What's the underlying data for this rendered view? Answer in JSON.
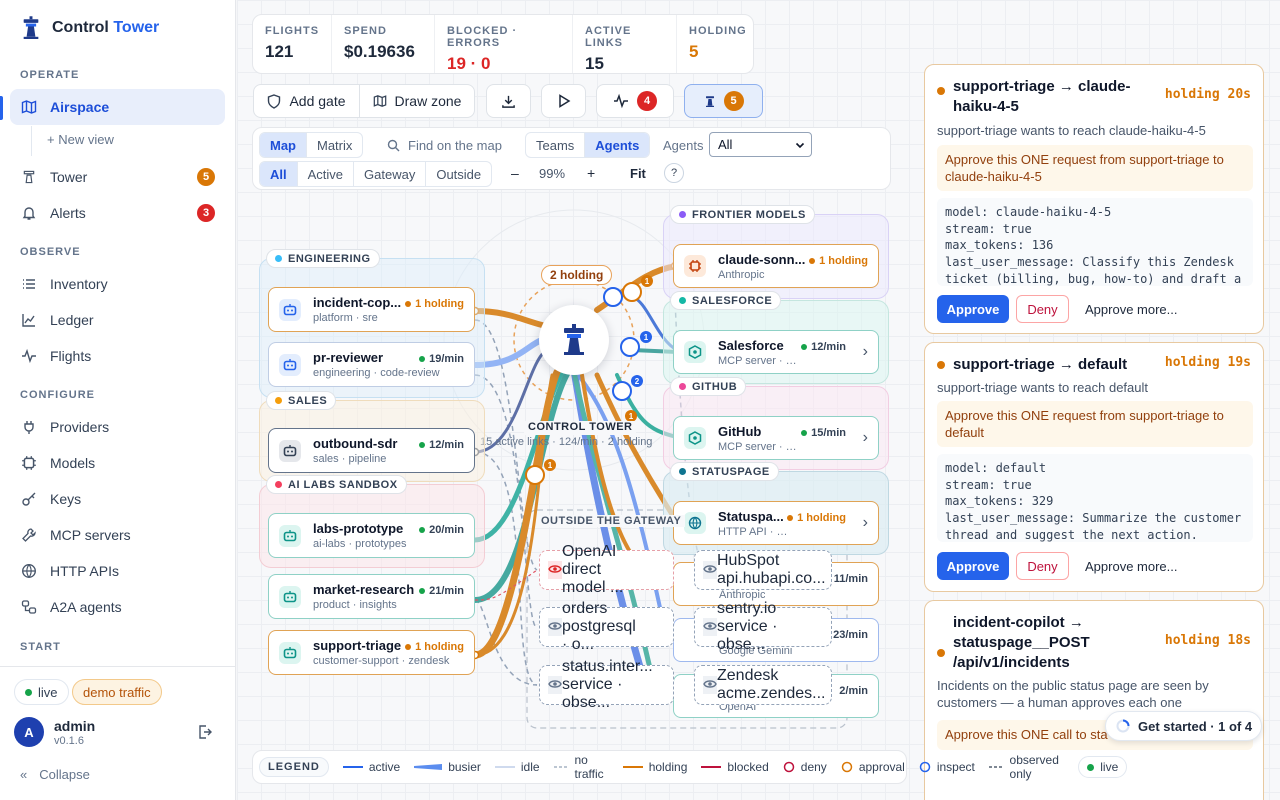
{
  "app": {
    "title_main": "Control",
    "title_accent": "Tower"
  },
  "sidebar": {
    "sections": {
      "operate": "OPERATE",
      "observe": "OBSERVE",
      "configure": "CONFIGURE",
      "start": "START"
    },
    "items": [
      {
        "label": "Airspace",
        "icon": "map-icon"
      },
      {
        "label": "Tower",
        "icon": "tower-icon",
        "badge": "5"
      },
      {
        "label": "Alerts",
        "icon": "bell-icon",
        "badge": "3"
      },
      {
        "label": "Inventory",
        "icon": "list-icon"
      },
      {
        "label": "Ledger",
        "icon": "line-chart-icon"
      },
      {
        "label": "Flights",
        "icon": "pulse-icon"
      },
      {
        "label": "Providers",
        "icon": "plug-icon"
      },
      {
        "label": "Models",
        "icon": "chip-icon"
      },
      {
        "label": "Keys",
        "icon": "key-icon"
      },
      {
        "label": "MCP servers",
        "icon": "wrench-icon"
      },
      {
        "label": "HTTP APIs",
        "icon": "globe-icon"
      },
      {
        "label": "A2A agents",
        "icon": "agents-icon"
      }
    ],
    "new_view": "+ New view",
    "live": "live",
    "demo": "demo traffic",
    "user": {
      "initial": "A",
      "name": "admin",
      "version": "v0.1.6"
    },
    "collapse": "Collapse"
  },
  "stats": [
    {
      "label": "FLIGHTS",
      "value": "121"
    },
    {
      "label": "SPEND",
      "value": "$0.19636"
    },
    {
      "label": "BLOCKED · ERRORS",
      "value": "19 · 0"
    },
    {
      "label": "ACTIVE LINKS",
      "value": "15"
    },
    {
      "label": "HOLDING",
      "value": "5"
    }
  ],
  "toolbar": {
    "add_gate": "Add gate",
    "draw_zone": "Draw zone",
    "alerts_count": "4",
    "tower_count": "5"
  },
  "filters": {
    "view_tabs": [
      "Map",
      "Matrix"
    ],
    "search_placeholder": "Find on the map",
    "group_tabs": [
      "Teams",
      "Agents"
    ],
    "agents_label": "Agents",
    "agents_selected": "All",
    "scope_tabs": [
      "All",
      "Active",
      "Gateway",
      "Outside"
    ],
    "zoom_minus": "–",
    "zoom": "99%",
    "zoom_plus": "+",
    "fit": "Fit",
    "help": "?"
  },
  "map": {
    "tower": {
      "label": "CONTROL TOWER",
      "sub": "15 active links · 124/min · 2 holding",
      "holding": "2 holding"
    },
    "groups": {
      "engineering": "ENGINEERING",
      "sales": "SALES",
      "ailabs": "AI LABS SANDBOX",
      "frontier": "FRONTIER MODELS",
      "salesforce": "SALESFORCE",
      "github": "GITHUB",
      "statuspage": "STATUSPAGE",
      "outside": "OUTSIDE THE GATEWAY"
    },
    "agents": [
      {
        "name": "incident-cop...",
        "sub": "platform · sre",
        "status": "1 holding"
      },
      {
        "name": "pr-reviewer",
        "sub": "engineering · code-review",
        "status": "19/min"
      },
      {
        "name": "outbound-sdr",
        "sub": "sales · pipeline",
        "status": "12/min"
      },
      {
        "name": "labs-prototype",
        "sub": "ai-labs · prototypes",
        "status": "20/min"
      },
      {
        "name": "market-research",
        "sub": "product · insights",
        "status": "21/min"
      },
      {
        "name": "support-triage",
        "sub": "customer-support · zendesk",
        "status": "1 holding"
      }
    ],
    "targets": [
      {
        "name": "claude-sonn...",
        "sub": "Anthropic",
        "status": "1 holding"
      },
      {
        "name": "Salesforce",
        "sub": "MCP server · 3 tools",
        "status": "12/min"
      },
      {
        "name": "GitHub",
        "sub": "MCP server · 2 tools",
        "status": "15/min"
      },
      {
        "name": "Statuspa...",
        "sub": "HTTP API · 3 routes",
        "status": "1 holding"
      }
    ],
    "hidden_targets": [
      {
        "sub": "Anthropic",
        "status": "11/min"
      },
      {
        "sub": "Google Gemini",
        "status": "23/min"
      },
      {
        "sub": "OpenAI",
        "status": "2/min"
      }
    ],
    "outside": [
      {
        "name": "OpenAI",
        "sub": "direct model ..."
      },
      {
        "name": "HubSpot",
        "sub": "api.hubapi.co..."
      },
      {
        "name": "orders",
        "sub": "postgresql · o..."
      },
      {
        "name": "sentry.io",
        "sub": "service · obse..."
      },
      {
        "name": "status.inter...",
        "sub": "service · obse..."
      },
      {
        "name": "Zendesk",
        "sub": "acme.zendes..."
      }
    ],
    "marker_counts": [
      "1",
      "1",
      "2",
      "1",
      "1"
    ]
  },
  "cards": [
    {
      "title": "support-triage → claude-haiku-4-5",
      "timer": "holding 20s",
      "desc": "support-triage wants to reach claude-haiku-4-5",
      "prompt": "Approve this ONE request from support-triage to claude-haiku-4-5",
      "code": "model: claude-haiku-4-5\nstream: true\nmax_tokens: 136\nlast_user_message: Classify this Zendesk\nticket (billing, bug, how-to) and draft a"
    },
    {
      "title": "support-triage → default",
      "timer": "holding 19s",
      "desc": "support-triage wants to reach default",
      "prompt": "Approve this ONE request from support-triage to default",
      "code": "model: default\nstream: true\nmax_tokens: 329\nlast_user_message: Summarize the customer\nthread and suggest the next action."
    },
    {
      "title": "incident-copilot → statuspage__POST /api/v1/incidents",
      "timer": "holding 18s",
      "desc": "Incidents on the public status page are seen by customers — a human approves each one",
      "prompt": "Approve this ONE call to sta"
    }
  ],
  "actions": {
    "approve": "Approve",
    "deny": "Deny",
    "more": "Approve more..."
  },
  "get_started": "Get started · 1 of 4",
  "legend": {
    "title": "LEGEND",
    "items": [
      "active",
      "busier",
      "idle",
      "no traffic",
      "holding",
      "blocked",
      "deny",
      "approval",
      "inspect",
      "observed only",
      "live"
    ]
  },
  "colors": {
    "accent": "#2563eb",
    "holding": "#d97706",
    "danger": "#dc2626",
    "live": "#16a34a"
  }
}
